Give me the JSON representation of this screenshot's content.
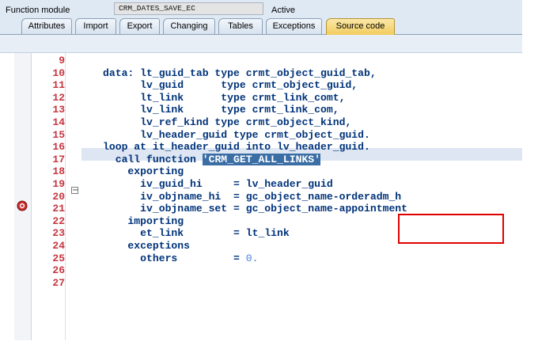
{
  "header": {
    "module_label": "Function module",
    "module_name": "CRM_DATES_SAVE_EC",
    "status": "Active"
  },
  "tabs": [
    {
      "label": "Attributes"
    },
    {
      "label": "Import"
    },
    {
      "label": "Export"
    },
    {
      "label": "Changing"
    },
    {
      "label": "Tables"
    },
    {
      "label": "Exceptions"
    },
    {
      "label": "Source code",
      "active": true
    }
  ],
  "editor": {
    "line_numbers": [
      "9",
      "10",
      "11",
      "12",
      "13",
      "14",
      "15",
      "16",
      "17",
      "18",
      "19",
      "20",
      "21",
      "22",
      "23",
      "24",
      "25",
      "26",
      "27"
    ],
    "lines": [
      "",
      "data: lt_guid_tab type crmt_object_guid_tab,",
      "      lv_guid      type crmt_object_guid,",
      "      lt_link      type crmt_link_comt,",
      "      lv_link      type crmt_link_com,",
      "      lv_ref_kind type crmt_object_kind,",
      "      lv_header_guid type crmt_object_guid.",
      "",
      "loop at it_header_guid into lv_header_guid.",
      "  call function ",
      "    exporting",
      "      iv_guid_hi     = lv_header_guid",
      "      iv_objname_hi  = gc_object_name-orderadm_h",
      "      iv_objname_set = gc_object_name-appointment",
      "    importing",
      "      et_link        = lt_link",
      "    exceptions",
      "      others         = ",
      ""
    ],
    "selected_string": "'CRM_GET_ALL_LINKS'",
    "others_value": "0.",
    "colors": {
      "line_number": "#c7353f",
      "keyword": "#1a3ea8",
      "selection": "#3a6ea5",
      "highlight_box": "#e00000"
    },
    "icons": {
      "breakpoint": "breakpoint-icon",
      "fold": "fold-toggle-icon"
    }
  }
}
